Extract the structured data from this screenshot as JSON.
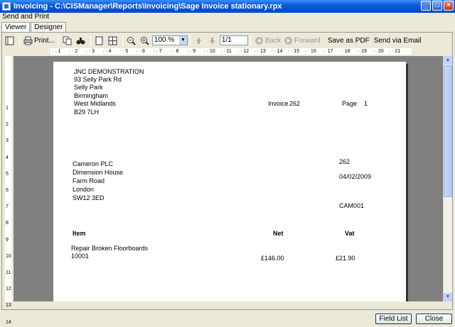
{
  "window": {
    "title": "Invoicing - C:\\CISManager\\Reports\\Invoicing\\Sage Invoice stationary.rpx",
    "minimize": "_",
    "maximize": "□",
    "close": "×"
  },
  "menu": {
    "label": "Send and Print"
  },
  "tabs": [
    {
      "label": "Viewer"
    },
    {
      "label": "Designer"
    }
  ],
  "toolbar": {
    "print": "Print...",
    "zoom": "100 %",
    "page": "1/1",
    "back": "Back",
    "forward": "Forward",
    "save_pdf": "Save as PDF",
    "send_email": "Send via Email"
  },
  "ruler": {
    "h_ticks": [
      "1",
      "2",
      "3",
      "4",
      "5",
      "6",
      "7",
      "8",
      "9",
      "10",
      "11",
      "12",
      "13",
      "14",
      "15",
      "16",
      "17",
      "18",
      "19",
      "20",
      "21"
    ],
    "v_ticks": [
      "1",
      "2",
      "3",
      "4",
      "5",
      "6",
      "7",
      "8",
      "9",
      "10",
      "11",
      "12",
      "13",
      "14"
    ]
  },
  "invoice": {
    "company": [
      "JNC  DEMONSTRATION",
      "93 Selly Park Rd",
      "Selly Park",
      "Birmingham",
      "West Midlands",
      "B29 7LH"
    ],
    "invoice_label": "Invoice",
    "invoice_no": "262",
    "page_label": "Page",
    "page_no": "1",
    "customer": [
      "Cameron PLC",
      "Dimension House",
      "Farm Road",
      "London",
      "SW12 3ED"
    ],
    "ref_no": "262",
    "date": "04/02/2009",
    "account": "CAM001",
    "col_item": "Item",
    "col_net": "Net",
    "col_vat": "Vat",
    "line_desc": "Repair Broken Floorboards",
    "line_code": "10001",
    "line_net": "£146.00",
    "line_vat": "£21.90"
  },
  "buttons": {
    "field_list": "Field List",
    "close": "Close"
  }
}
